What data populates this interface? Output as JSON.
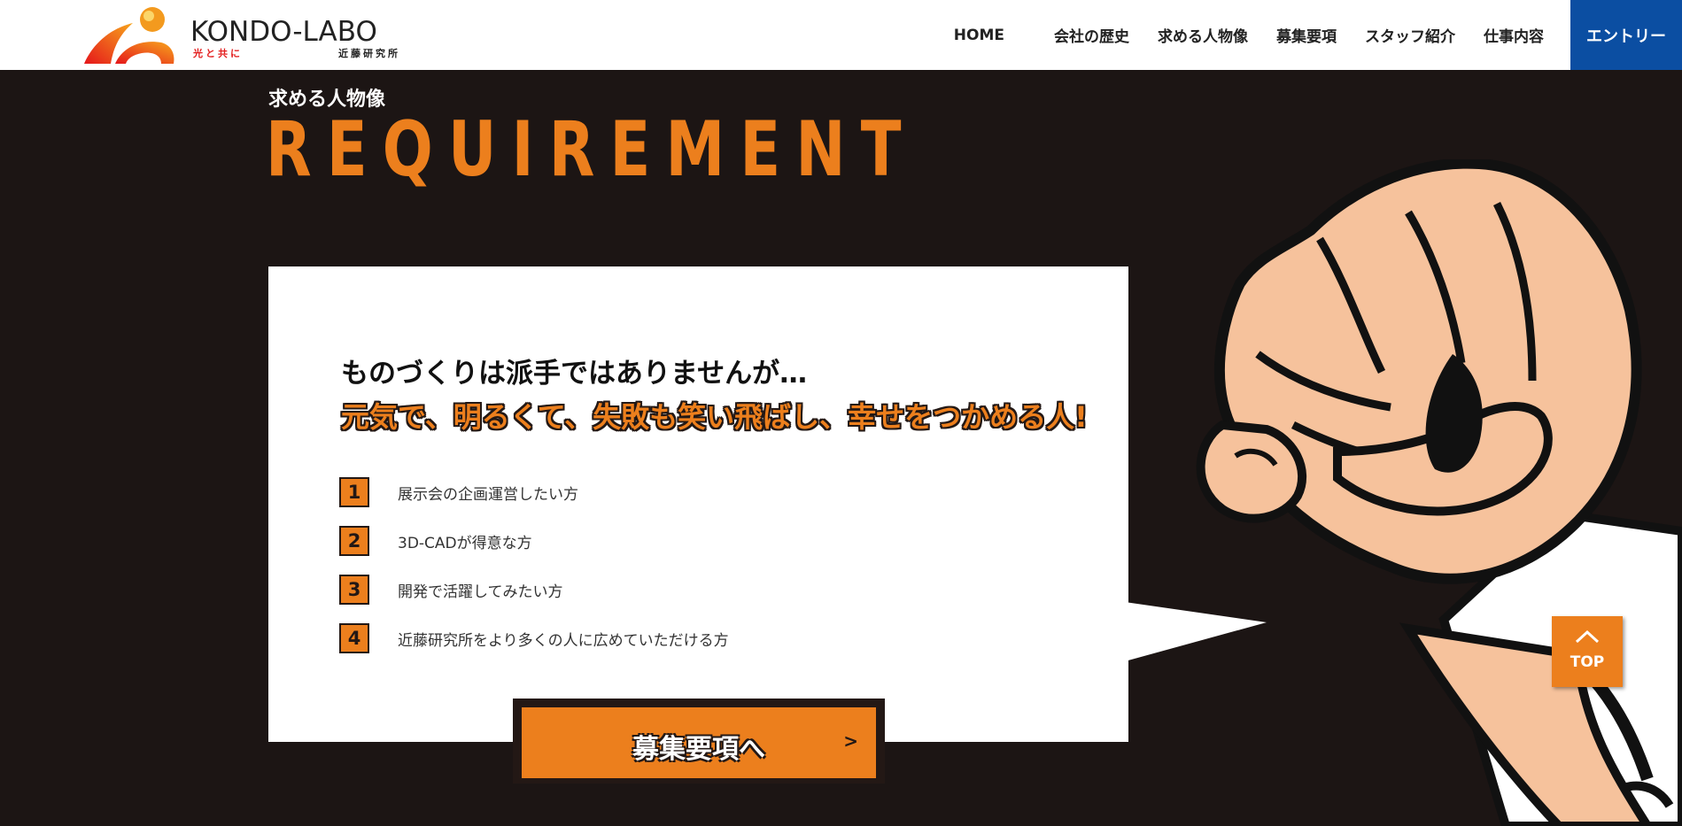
{
  "brand": {
    "logo_text": "KONDO-LABO",
    "tagline": "光と共に",
    "company_jp": "近藤研究所"
  },
  "nav": {
    "home": "HOME",
    "history": "会社の歴史",
    "requirement": "求める人物像",
    "recruit": "募集要項",
    "staff": "スタッフ紹介",
    "work": "仕事内容",
    "entry": "エントリー"
  },
  "section": {
    "title_jp": "求める人物像",
    "title_en": "REQUIREMENT"
  },
  "card": {
    "lead1": "ものづくりは派手ではありませんが…",
    "lead2": "元気で、明るくて、失敗も笑い飛ばし、幸せをつかめる人!",
    "items": [
      {
        "num": "1",
        "text": "展示会の企画運営したい方"
      },
      {
        "num": "2",
        "text": "3D-CADが得意な方"
      },
      {
        "num": "3",
        "text": "開発で活躍してみたい方"
      },
      {
        "num": "4",
        "text": "近藤研究所をより多くの人に広めていただける方"
      }
    ]
  },
  "cta": {
    "label": "募集要項へ",
    "arrow": ">"
  },
  "top_button": {
    "label": "TOP",
    "icon": "chevron-up-icon"
  },
  "colors": {
    "background": "#1c1514",
    "accent_orange": "#ec7f1d",
    "entry_blue": "#0b4ea2",
    "skin": "#f6c29c"
  }
}
